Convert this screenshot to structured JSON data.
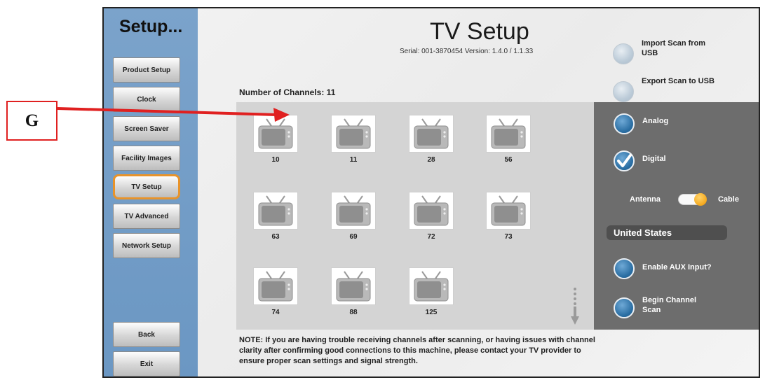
{
  "sidebar": {
    "title": "Setup...",
    "items": [
      {
        "label": "Product Setup",
        "active": false
      },
      {
        "label": "Clock",
        "active": false
      },
      {
        "label": "Screen Saver",
        "active": false
      },
      {
        "label": "Facility Images",
        "active": false
      },
      {
        "label": "TV Setup",
        "active": true
      },
      {
        "label": "TV Advanced",
        "active": false
      },
      {
        "label": "Network Setup",
        "active": false
      }
    ],
    "back_label": "Back",
    "exit_label": "Exit"
  },
  "header": {
    "title": "TV Setup",
    "serial": "Serial: 001-3870454  Version: 1.4.0 / 1.1.33"
  },
  "channels": {
    "count_label": "Number of Channels: 11",
    "list": [
      "10",
      "11",
      "28",
      "56",
      "63",
      "69",
      "72",
      "73",
      "74",
      "88",
      "125"
    ]
  },
  "note": "NOTE: If you are having trouble receiving channels after scanning, or having issues with channel clarity after confirming good connections to this machine, please contact your TV provider to ensure proper scan settings and signal strength.",
  "options": {
    "import_label": "Import Scan from USB",
    "export_label": "Export Scan to USB",
    "analog_label": "Analog",
    "analog_checked": false,
    "digital_label": "Digital",
    "digital_checked": true,
    "antenna_label": "Antenna",
    "cable_label": "Cable",
    "input_mode": "Cable",
    "region": "United States",
    "aux_label": "Enable AUX Input?",
    "scan_label": "Begin Channel Scan"
  },
  "annotation": {
    "callout_letter": "G"
  },
  "colors": {
    "sidebar_blue": "#6b97c3",
    "active_outline": "#e8932a",
    "callout_red": "#e02020",
    "radio_blue": "#2a6ea3",
    "panel_gray": "#6d6d6d"
  },
  "icons": {
    "channel_tile": "tv-icon",
    "checked": "checkmark-icon",
    "scroll": "scroll-down-arrow-icon"
  }
}
